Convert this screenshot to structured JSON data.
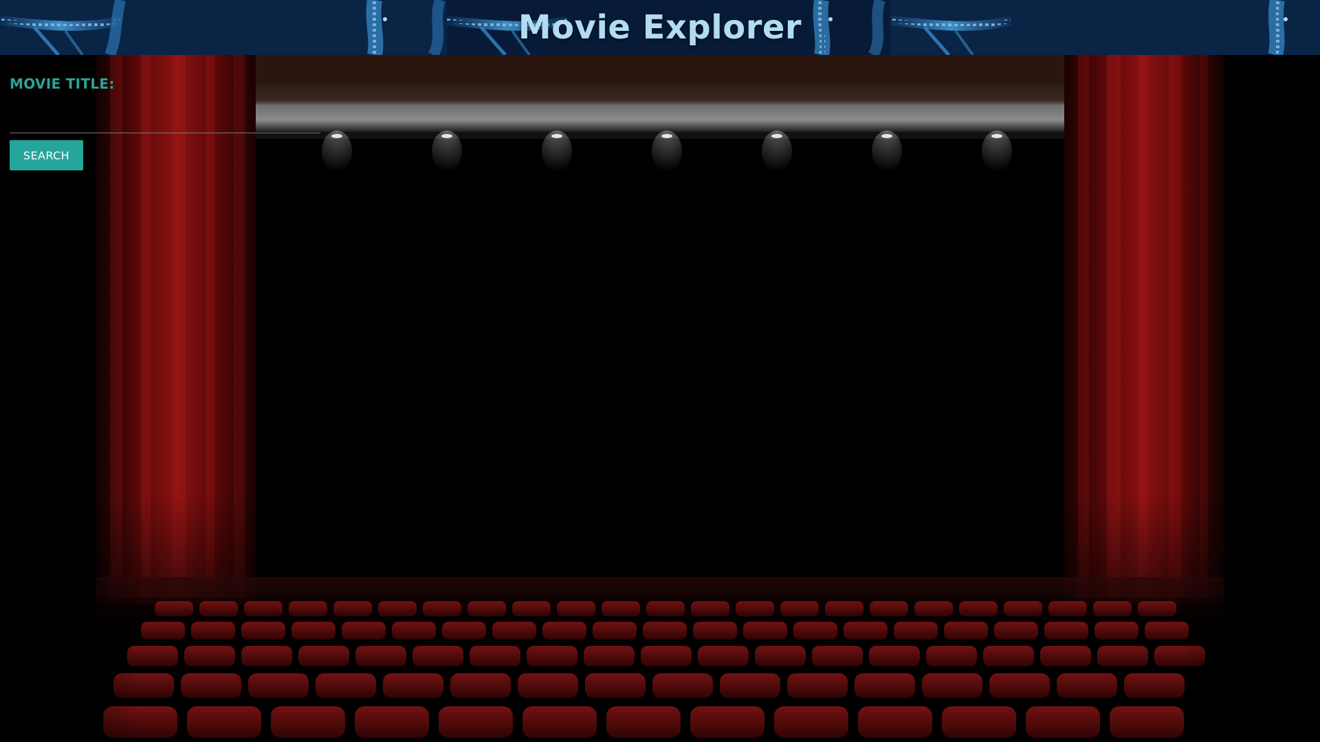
{
  "header": {
    "title": "Movie Explorer",
    "background_icon": "film-strip-icon"
  },
  "search": {
    "label": "MOVIE TITLE:",
    "value": "",
    "placeholder": "",
    "button_label": "SEARCH"
  },
  "background": {
    "scene": "theater-stage-image",
    "curtain_color": "#7a0c0c",
    "seat_color": "#8e1313"
  },
  "colors": {
    "header_bg": "#071a36",
    "title_text": "#b2dcef",
    "label_text": "#2aa497",
    "button_bg": "#26a69a",
    "button_text": "#ffffff"
  }
}
